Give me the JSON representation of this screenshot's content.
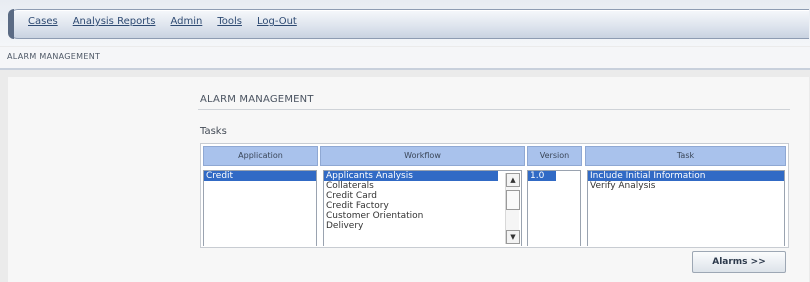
{
  "nav": {
    "items": [
      {
        "label": "Cases"
      },
      {
        "label": "Analysis Reports"
      },
      {
        "label": "Admin"
      },
      {
        "label": "Tools"
      },
      {
        "label": "Log-Out"
      }
    ]
  },
  "breadcrumb": "ALARM MANAGEMENT",
  "page_title": "ALARM MANAGEMENT",
  "section_label": "Tasks",
  "columns": {
    "application": {
      "header": "Application",
      "options": [
        "Credit"
      ],
      "selected": "Credit"
    },
    "workflow": {
      "header": "Workflow",
      "options": [
        "Applicants Analysis",
        "Collaterals",
        "Credit Card",
        "Credit Factory",
        "Customer Orientation",
        "Delivery"
      ],
      "selected": "Applicants Analysis"
    },
    "version": {
      "header": "Version",
      "options": [
        "1.0"
      ],
      "selected": "1.0"
    },
    "task": {
      "header": "Task",
      "options": [
        "Include Initial Information",
        "Verify Analysis"
      ],
      "selected": "Include Initial Information"
    }
  },
  "alarms_button": "Alarms >>",
  "colors": {
    "header_fill": "#a9c2ec",
    "selection": "#316ac5",
    "nav_text": "#2e4a72"
  }
}
